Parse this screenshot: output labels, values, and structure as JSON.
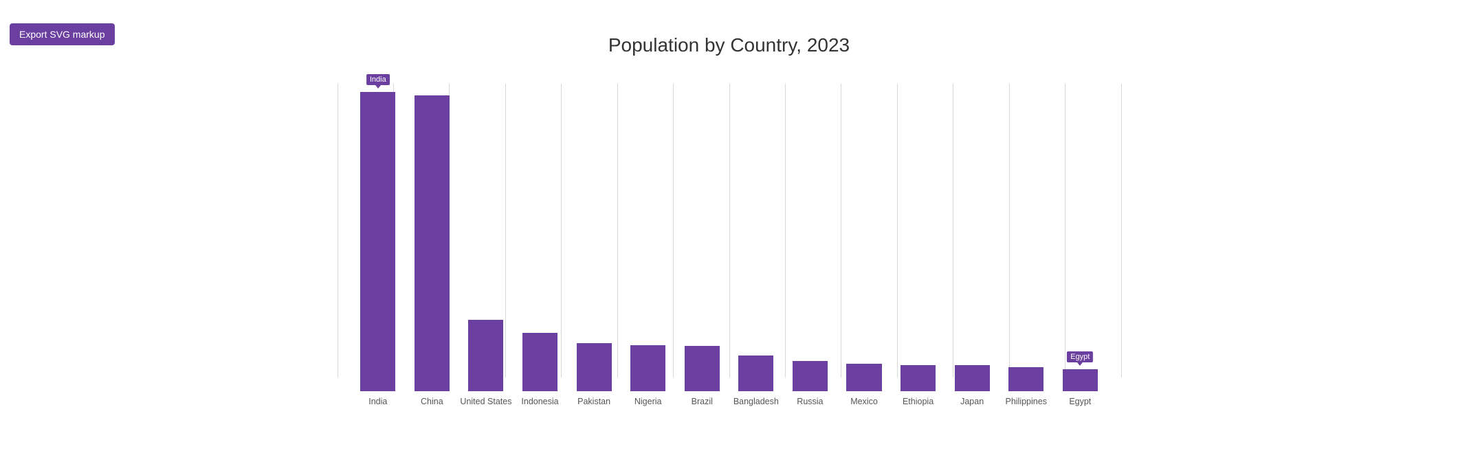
{
  "toolbar": {
    "export_label": "Export SVG markup"
  },
  "chart": {
    "title": "Population by Country, 2023",
    "bar_color": "#6b3fa0",
    "max_population": 1440,
    "countries": [
      {
        "name": "India",
        "population": 1428,
        "tooltip": "India",
        "show_tooltip": true
      },
      {
        "name": "China",
        "population": 1410,
        "tooltip": null,
        "show_tooltip": false
      },
      {
        "name": "United States",
        "population": 340,
        "tooltip": null,
        "show_tooltip": false
      },
      {
        "name": "Indonesia",
        "population": 278,
        "tooltip": null,
        "show_tooltip": false
      },
      {
        "name": "Pakistan",
        "population": 230,
        "tooltip": null,
        "show_tooltip": false
      },
      {
        "name": "Nigeria",
        "population": 220,
        "tooltip": null,
        "show_tooltip": false
      },
      {
        "name": "Brazil",
        "population": 215,
        "tooltip": null,
        "show_tooltip": false
      },
      {
        "name": "Bangladesh",
        "population": 170,
        "tooltip": null,
        "show_tooltip": false
      },
      {
        "name": "Russia",
        "population": 145,
        "tooltip": null,
        "show_tooltip": false
      },
      {
        "name": "Mexico",
        "population": 130,
        "tooltip": null,
        "show_tooltip": false
      },
      {
        "name": "Ethiopia",
        "population": 125,
        "tooltip": null,
        "show_tooltip": false
      },
      {
        "name": "Japan",
        "population": 123,
        "tooltip": null,
        "show_tooltip": false
      },
      {
        "name": "Philippines",
        "population": 115,
        "tooltip": null,
        "show_tooltip": false
      },
      {
        "name": "Egypt",
        "population": 105,
        "tooltip": "Egypt",
        "show_tooltip": true
      }
    ]
  }
}
